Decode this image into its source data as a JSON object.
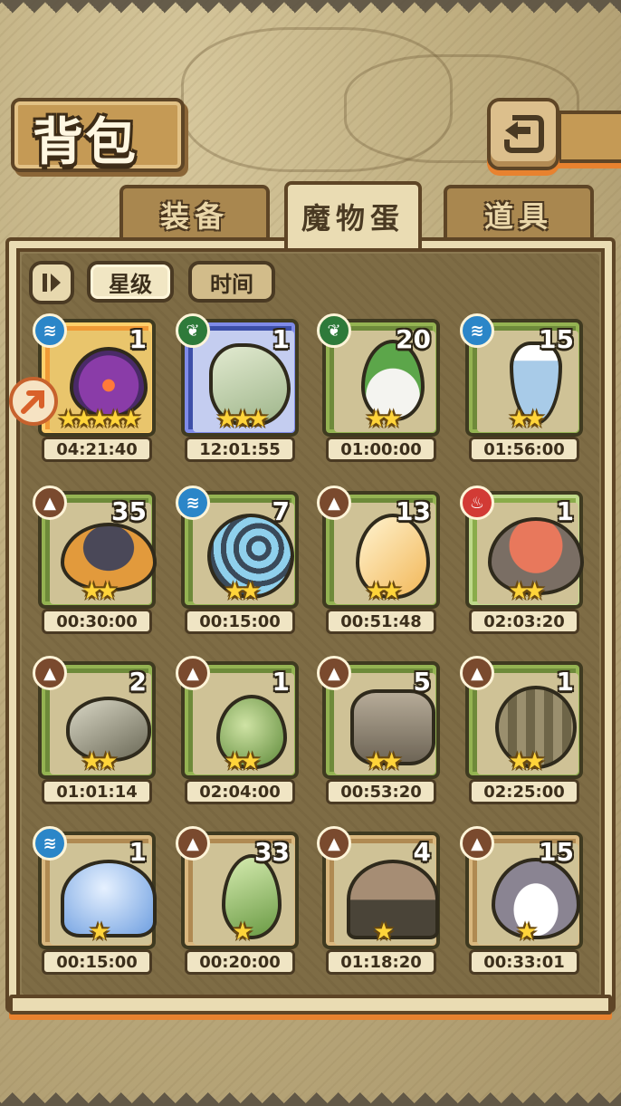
{
  "header": {
    "title": "背包"
  },
  "tabs": [
    {
      "label": "装备",
      "active": false
    },
    {
      "label": "魔物蛋",
      "active": true
    },
    {
      "label": "道具",
      "active": false
    }
  ],
  "sort": {
    "toggle_icon": "sort-toggle-icon",
    "star_label": "星级",
    "time_label": "时间"
  },
  "eggs": [
    {
      "count": "1",
      "stars": "★★★★★",
      "timer": "04:21:40",
      "element": "water",
      "frame": "purple"
    },
    {
      "count": "1",
      "stars": "★★★",
      "timer": "12:01:55",
      "element": "grass",
      "frame": "blue"
    },
    {
      "count": "20",
      "stars": "★★",
      "timer": "01:00:00",
      "element": "grass",
      "frame": "green"
    },
    {
      "count": "15",
      "stars": "★★",
      "timer": "01:56:00",
      "element": "water",
      "frame": "green"
    },
    {
      "count": "35",
      "stars": "★★",
      "timer": "00:30:00",
      "element": "earth",
      "frame": "green"
    },
    {
      "count": "7",
      "stars": "★★",
      "timer": "00:15:00",
      "element": "water",
      "frame": "green"
    },
    {
      "count": "13",
      "stars": "★★",
      "timer": "00:51:48",
      "element": "earth",
      "frame": "green"
    },
    {
      "count": "1",
      "stars": "★★",
      "timer": "02:03:20",
      "element": "fire",
      "frame": "lightgreen"
    },
    {
      "count": "2",
      "stars": "★★",
      "timer": "01:01:14",
      "element": "earth",
      "frame": "green"
    },
    {
      "count": "1",
      "stars": "★★",
      "timer": "02:04:00",
      "element": "earth",
      "frame": "green"
    },
    {
      "count": "5",
      "stars": "★★",
      "timer": "00:53:20",
      "element": "earth",
      "frame": "green"
    },
    {
      "count": "1",
      "stars": "★★",
      "timer": "02:25:00",
      "element": "earth",
      "frame": "green"
    },
    {
      "count": "1",
      "stars": "★",
      "timer": "00:15:00",
      "element": "water",
      "frame": "brown"
    },
    {
      "count": "33",
      "stars": "★",
      "timer": "00:20:00",
      "element": "earth",
      "frame": "brown"
    },
    {
      "count": "4",
      "stars": "★",
      "timer": "01:18:20",
      "element": "earth",
      "frame": "brown"
    },
    {
      "count": "15",
      "stars": "★",
      "timer": "00:33:01",
      "element": "earth",
      "frame": "brown"
    }
  ],
  "colors": {
    "panel": "#7e6c45",
    "accent": "#e8822f",
    "star": "#ffd43a"
  }
}
